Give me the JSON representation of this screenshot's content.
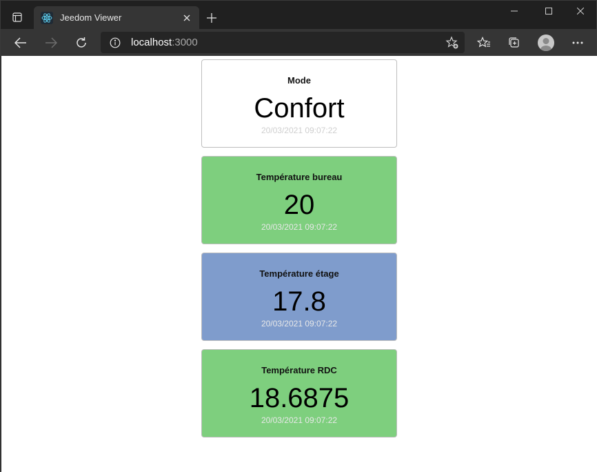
{
  "browser": {
    "tab_title": "Jeedom Viewer",
    "url_host": "localhost",
    "url_port": ":3000",
    "icons": {
      "tab_actions": "tab-actions-icon",
      "favicon": "react-icon",
      "close_tab": "close-icon",
      "new_tab": "plus-icon",
      "back": "back-arrow-icon",
      "forward": "forward-arrow-icon",
      "refresh": "refresh-icon",
      "site_info": "info-icon",
      "add_favorite": "star-plus-icon",
      "favorites": "favorites-icon",
      "collections": "collections-icon",
      "profile": "avatar-icon",
      "menu": "more-icon"
    }
  },
  "cards": [
    {
      "title": "Mode",
      "value": "Confort",
      "date": "20/03/2021 09:07:22",
      "color": "#ffffff"
    },
    {
      "title": "Température bureau",
      "value": "20",
      "date": "20/03/2021 09:07:22",
      "color": "#7ecf7e"
    },
    {
      "title": "Température étage",
      "value": "17.8",
      "date": "20/03/2021 09:07:22",
      "color": "#7f9ccc"
    },
    {
      "title": "Température RDC",
      "value": "18.6875",
      "date": "20/03/2021 09:07:22",
      "color": "#7ecf7e"
    }
  ]
}
